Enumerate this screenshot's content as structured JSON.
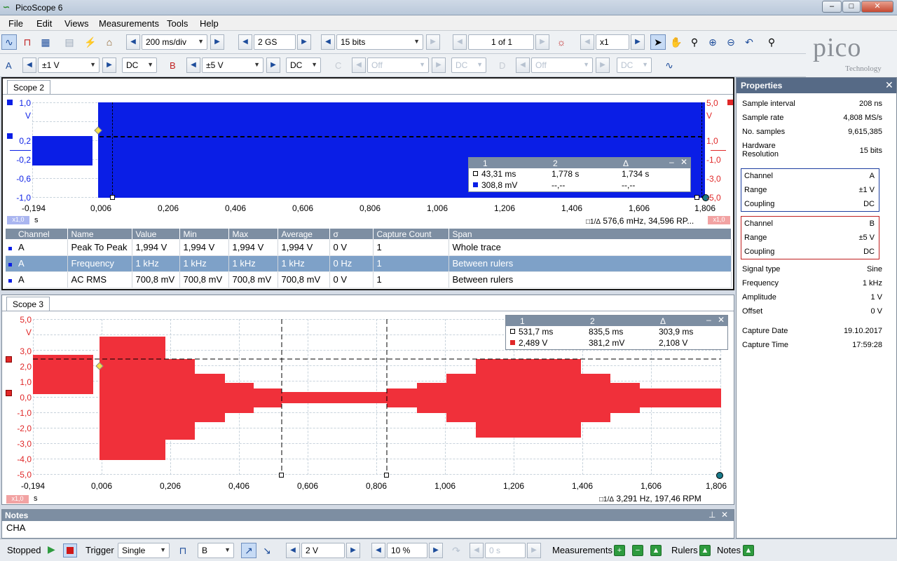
{
  "window": {
    "title": "PicoScope 6",
    "min": "–",
    "max": "□",
    "close": "✕"
  },
  "menu": [
    "File",
    "Edit",
    "Views",
    "Measurements",
    "Tools",
    "Help"
  ],
  "toolbar1": {
    "timebase": "200 ms/div",
    "samples": "2 GS",
    "resolution": "15 bits",
    "buffer": "1 of 1",
    "zoom": "x1"
  },
  "logo": {
    "brand": "pico",
    "sub": "Technology"
  },
  "toolbar2": {
    "chA": {
      "label": "A",
      "range": "±1 V",
      "coupling": "DC"
    },
    "chB": {
      "label": "B",
      "range": "±5 V",
      "coupling": "DC"
    },
    "chC": {
      "label": "C",
      "range": "Off",
      "coupling": "DC"
    },
    "chD": {
      "label": "D",
      "range": "Off",
      "coupling": "DC"
    }
  },
  "scope2": {
    "tab": "Scope 2",
    "yleft": [
      "1,0",
      "V",
      "0,2",
      "-0,2",
      "-0,6",
      "-1,0"
    ],
    "yright": [
      "5,0",
      "V",
      "1,0",
      "-1,0",
      "-3,0",
      "-5,0"
    ],
    "x": [
      "-0,194",
      "0,006",
      "0,206",
      "0,406",
      "0,606",
      "0,806",
      "1,006",
      "1,206",
      "1,406",
      "1,606",
      "1,806"
    ],
    "xunit": "s",
    "zoomA": "x1,0",
    "zoomB": "x1,0",
    "readout": "576,6 mHz, 34,596 RP...",
    "rulers": {
      "h1": "1",
      "h2": "2",
      "hd": "Δ",
      "r1c1": "43,31 ms",
      "r1c2": "1,778 s",
      "r1c3": "1,734 s",
      "r2c1": "308,8 mV",
      "r2c2": "--,--",
      "r2c3": "--,--"
    },
    "colors": {
      "trace": "#0a1ee6"
    }
  },
  "measurements": {
    "headers": [
      "Channel",
      "Name",
      "Value",
      "Min",
      "Max",
      "Average",
      "σ",
      "Capture Count",
      "Span"
    ],
    "rows": [
      [
        "A",
        "Peak To Peak",
        "1,994 V",
        "1,994 V",
        "1,994 V",
        "1,994 V",
        "0 V",
        "1",
        "Whole trace"
      ],
      [
        "A",
        "Frequency",
        "1 kHz",
        "1 kHz",
        "1 kHz",
        "1 kHz",
        "0 Hz",
        "1",
        "Between rulers"
      ],
      [
        "A",
        "AC RMS",
        "700,8 mV",
        "700,8 mV",
        "700,8 mV",
        "700,8 mV",
        "0 V",
        "1",
        "Between rulers"
      ]
    ]
  },
  "scope3": {
    "tab": "Scope 3",
    "y": [
      "5,0",
      "V",
      "3,0",
      "2,0",
      "1,0",
      "0,0",
      "-1,0",
      "-2,0",
      "-3,0",
      "-4,0",
      "-5,0"
    ],
    "x": [
      "-0,194",
      "0,006",
      "0,206",
      "0,406",
      "0,606",
      "0,806",
      "1,006",
      "1,206",
      "1,406",
      "1,606",
      "1,806"
    ],
    "xunit": "s",
    "zoom": "x1,0",
    "readout": "3,291 Hz, 197,46 RPM",
    "rulers": {
      "h1": "1",
      "h2": "2",
      "hd": "Δ",
      "r1c1": "531,7 ms",
      "r1c2": "835,5 ms",
      "r1c3": "303,9 ms",
      "r2c1": "2,489 V",
      "r2c2": "381,2 mV",
      "r2c3": "2,108 V"
    },
    "colors": {
      "trace": "#f0303a"
    }
  },
  "notes": {
    "title": "Notes",
    "text": "CHA"
  },
  "properties": {
    "title": "Properties",
    "general": [
      [
        "Sample interval",
        "208 ns"
      ],
      [
        "Sample rate",
        "4,808 MS/s"
      ],
      [
        "No. samples",
        "9,615,385"
      ]
    ],
    "hwres_label": "Hardware Resolution",
    "hwres_value": "15 bits",
    "chA": [
      [
        "Channel",
        "A"
      ],
      [
        "Range",
        "±1 V"
      ],
      [
        "Coupling",
        "DC"
      ]
    ],
    "chB": [
      [
        "Channel",
        "B"
      ],
      [
        "Range",
        "±5 V"
      ],
      [
        "Coupling",
        "DC"
      ]
    ],
    "signal": [
      [
        "Signal type",
        "Sine"
      ],
      [
        "Frequency",
        "1 kHz"
      ],
      [
        "Amplitude",
        "1 V"
      ],
      [
        "Offset",
        "0 V"
      ]
    ],
    "capture": [
      [
        "Capture Date",
        "19.10.2017"
      ],
      [
        "Capture Time",
        "17:59:28"
      ]
    ]
  },
  "statusbar": {
    "state": "Stopped",
    "trigger": "Trigger",
    "mode": "Single",
    "source": "B",
    "level": "2 V",
    "pretrigger": "10 %",
    "delay": "0 s",
    "measurements": "Measurements",
    "rulers": "Rulers",
    "notes": "Notes"
  }
}
